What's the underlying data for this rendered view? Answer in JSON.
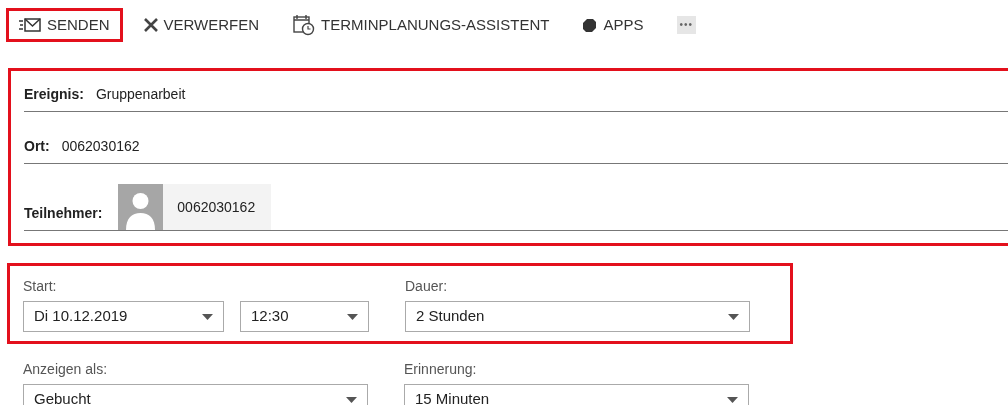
{
  "toolbar": [
    {
      "kind": "send",
      "label": "SENDEN",
      "highlighted": true
    },
    {
      "kind": "discard",
      "label": "VERWERFEN",
      "highlighted": false
    },
    {
      "kind": "scheduling",
      "label": "TERMINPLANUNGS-ASSISTENT",
      "highlighted": false
    },
    {
      "kind": "apps",
      "label": "APPS",
      "highlighted": false
    },
    {
      "kind": "more",
      "label": "•••",
      "highlighted": false
    }
  ],
  "details": {
    "highlighted": true,
    "fields": [
      {
        "kind": "text",
        "label": "Ereignis:",
        "value": "Gruppenarbeit"
      },
      {
        "kind": "text",
        "label": "Ort:",
        "value": "0062030162"
      },
      {
        "kind": "person",
        "label": "Teilnehmer:",
        "value": "0062030162"
      }
    ]
  },
  "time": {
    "highlighted": true,
    "groups": [
      {
        "label": "Start:",
        "dropdowns": [
          {
            "value": "Di 10.12.2019"
          },
          {
            "value": "12:30"
          }
        ]
      },
      {
        "label": "Dauer:",
        "dropdowns": [
          {
            "value": "2 Stunden"
          }
        ]
      }
    ]
  },
  "options": {
    "groups": [
      {
        "label": "Anzeigen als:",
        "dropdowns": [
          {
            "value": "Gebucht"
          }
        ]
      },
      {
        "label": "Erinnerung:",
        "dropdowns": [
          {
            "value": "15 Minuten"
          }
        ]
      }
    ]
  }
}
